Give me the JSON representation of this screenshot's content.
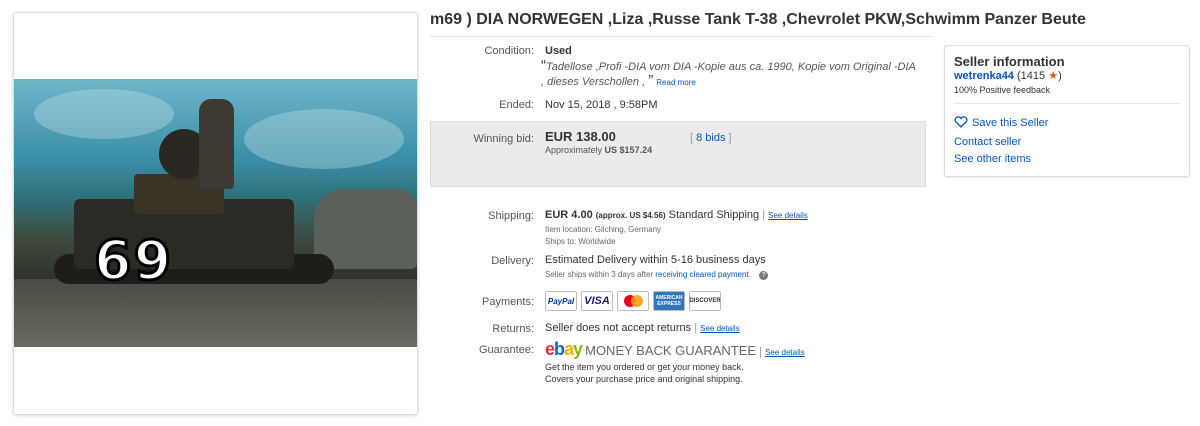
{
  "title": "m69 ) DIA NORWEGEN ,Liza ,Russe Tank T-38 ,Chevrolet PKW,Schwimm Panzer Beute",
  "image": {
    "overlay_number": "69"
  },
  "condition": {
    "label": "Condition:",
    "value": "Used",
    "open_quote": "“",
    "close_quote": "”",
    "quote_text": "Tadellose ,Profi -DIA vom DIA -Kopie aus ca. 1990, Kopie vom Original -DIA , dieses Verschollen ,",
    "read_more": "Read more"
  },
  "ended": {
    "label": "Ended:",
    "value": "Nov 15, 2018 , 9:58PM"
  },
  "bid": {
    "label": "Winning bid:",
    "amount": "EUR 138.00",
    "approx_prefix": "Approximately",
    "approx_value": "US $157.24",
    "bids_open": "[",
    "bids_link": "8 bids",
    "bids_close": "]"
  },
  "shipping": {
    "label": "Shipping:",
    "amount": "EUR 4.00",
    "approx": "(approx. US $4.56)",
    "method": "Standard Shipping",
    "see_details": "See details",
    "item_location": "Item location:  Gilching, Germany",
    "ships_to": "Ships to:  Worldwide"
  },
  "delivery": {
    "label": "Delivery:",
    "value": "Estimated Delivery within 5-16 business days",
    "note_prefix": "Seller ships within 3 days after",
    "note_link": "receiving cleared payment",
    "note_suffix": "."
  },
  "payments": {
    "label": "Payments:",
    "methods": [
      "PayPal",
      "VISA",
      "MasterCard",
      "AMERICAN EXPRESS",
      "DISCOVER"
    ]
  },
  "returns": {
    "label": "Returns:",
    "value": "Seller does not accept returns",
    "see_details": "See details"
  },
  "guarantee": {
    "label": "Guarantee:",
    "logo": {
      "e": "e",
      "b": "b",
      "a": "a",
      "y": "y"
    },
    "name": "MONEY BACK GUARANTEE",
    "see_details": "See details",
    "line1": "Get the item you ordered or get your money back.",
    "line2": "Covers your purchase price and original shipping."
  },
  "seller": {
    "title": "Seller information",
    "name": "wetrenka44",
    "score": "(1415",
    "score_close": ")",
    "feedback": "100% Positive feedback",
    "save": "Save this Seller",
    "contact": "Contact seller",
    "other_items": "See other items"
  },
  "colors": {
    "link": "#0654ba",
    "bid_box": "#ebebeb",
    "star": "#e85c12"
  }
}
